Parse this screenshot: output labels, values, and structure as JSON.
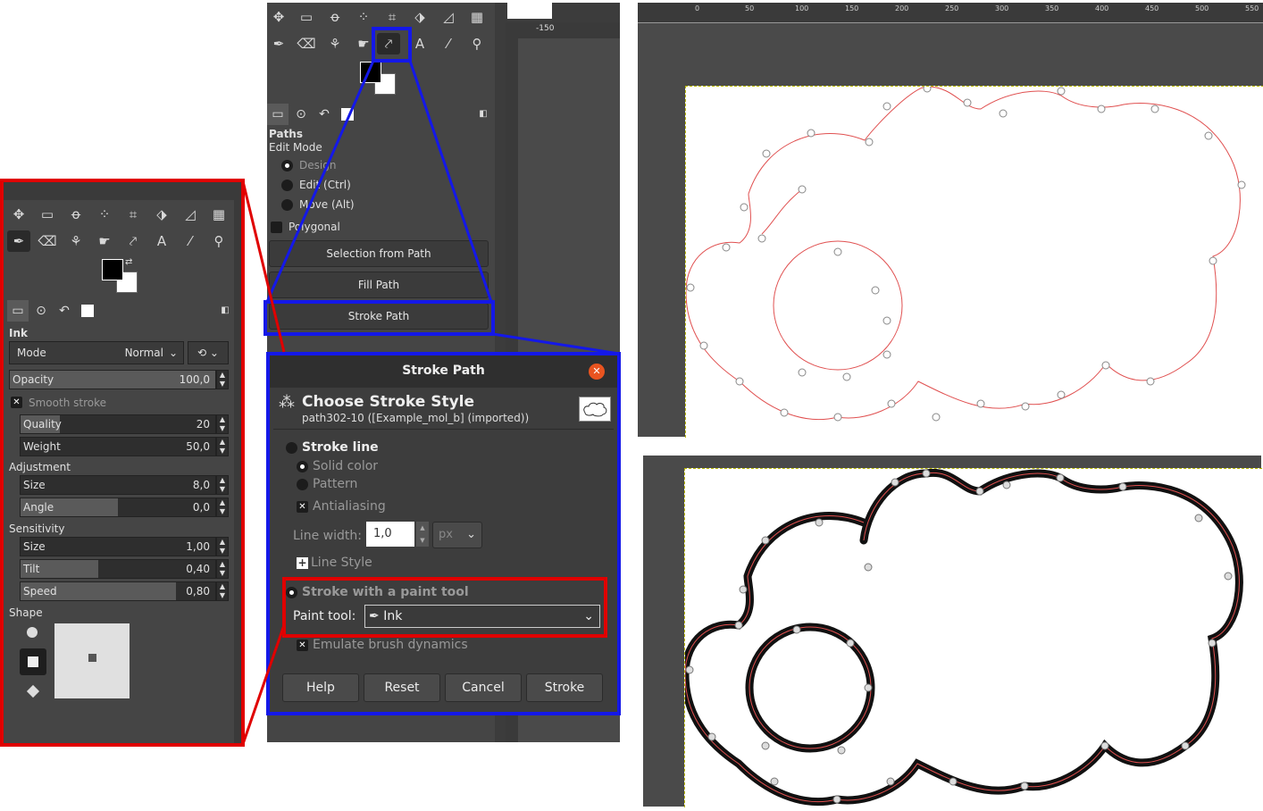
{
  "ink_panel": {
    "section_title": "Ink",
    "mode_label": "Mode",
    "mode_value": "Normal",
    "opacity": {
      "label": "Opacity",
      "value": "100,0",
      "fraction": 1.0
    },
    "smooth_stroke": "Smooth stroke",
    "quality": {
      "label": "Quality",
      "value": "20",
      "fraction": 0.2
    },
    "weight": {
      "label": "Weight",
      "value": "50,0",
      "fraction": 0.0
    },
    "adjustment_title": "Adjustment",
    "size": {
      "label": "Size",
      "value": "8,0",
      "fraction": 0.0
    },
    "angle": {
      "label": "Angle",
      "value": "0,0",
      "fraction": 0.5
    },
    "sensitivity_title": "Sensitivity",
    "sens_size": {
      "label": "Size",
      "value": "1,00",
      "fraction": 0.0
    },
    "tilt": {
      "label": "Tilt",
      "value": "0,40",
      "fraction": 0.4
    },
    "speed": {
      "label": "Speed",
      "value": "0,80",
      "fraction": 0.8
    },
    "shape_title": "Shape"
  },
  "paths_panel": {
    "title": "Paths",
    "edit_mode": "Edit Mode",
    "design": "Design",
    "edit": "Edit (Ctrl)",
    "move": "Move (Alt)",
    "polygonal": "Polygonal",
    "selection_from_path": "Selection from Path",
    "fill_path": "Fill Path",
    "stroke_path": "Stroke Path"
  },
  "ruler": {
    "label": "-150"
  },
  "dialog": {
    "title": "Stroke Path",
    "heading": "Choose Stroke Style",
    "subheading": "path302-10 ([Example_mol_b] (imported))",
    "stroke_line": "Stroke line",
    "solid_color": "Solid color",
    "pattern": "Pattern",
    "antialiasing": "Antialiasing",
    "line_width_label": "Line width:",
    "line_width_value": "1,0",
    "unit": "px",
    "line_style": "Line Style",
    "stroke_paint_tool": "Stroke with a paint tool",
    "paint_tool_label": "Paint tool:",
    "paint_tool_value": "Ink",
    "emulate": "Emulate brush dynamics",
    "buttons": {
      "help": "Help",
      "reset": "Reset",
      "cancel": "Cancel",
      "stroke": "Stroke"
    }
  },
  "top_ruler": {
    "ticks": [
      "0",
      "50",
      "100",
      "150",
      "200",
      "250",
      "300",
      "350",
      "400",
      "450",
      "500",
      "550"
    ]
  },
  "colors": {
    "highlight_red": "#e00000",
    "highlight_blue": "#1418e8",
    "path_red": "#e05050",
    "panel_bg": "#454545"
  }
}
